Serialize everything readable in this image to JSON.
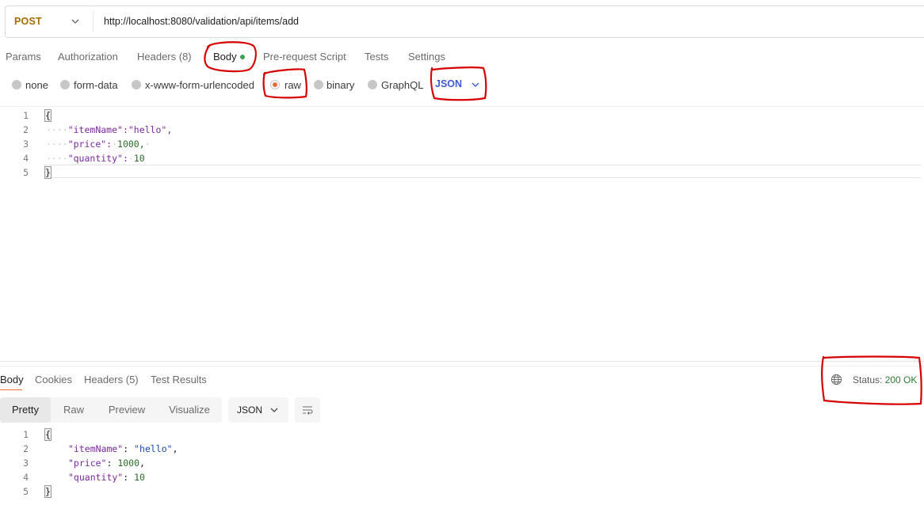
{
  "request": {
    "method": "POST",
    "url": "http://localhost:8080/validation/api/items/add"
  },
  "request_tabs": {
    "params": "Params",
    "authorization": "Authorization",
    "headers": "Headers (8)",
    "body": "Body",
    "pre_request": "Pre-request Script",
    "tests": "Tests",
    "settings": "Settings"
  },
  "body_types": {
    "none": "none",
    "form_data": "form-data",
    "urlencoded": "x-www-form-urlencoded",
    "raw": "raw",
    "binary": "binary",
    "graphql": "GraphQL",
    "selected": "raw",
    "format": "JSON"
  },
  "request_body": {
    "line_numbers": [
      "1",
      "2",
      "3",
      "4",
      "5"
    ],
    "open_brace": "{",
    "line2_key": "\"itemName\":\"hello\",",
    "line3_key": "\"price\":",
    "line3_val": "1000,",
    "line4_key": "\"quantity\":",
    "line4_val": "10",
    "close_brace": "}"
  },
  "response_tabs": {
    "body": "Body",
    "cookies": "Cookies",
    "headers": "Headers (5)",
    "test_results": "Test Results"
  },
  "status": {
    "label": "Status:",
    "value": "200 OK"
  },
  "view_modes": {
    "pretty": "Pretty",
    "raw": "Raw",
    "preview": "Preview",
    "visualize": "Visualize",
    "format": "JSON"
  },
  "response_body": {
    "line_numbers": [
      "1",
      "2",
      "3",
      "4",
      "5"
    ],
    "open_brace": "{",
    "l2_key": "\"itemName\"",
    "l2_val": "\"hello\"",
    "l3_key": "\"price\"",
    "l3_val": "1000",
    "l4_key": "\"quantity\"",
    "l4_val": "10",
    "close_brace": "}"
  },
  "colors": {
    "method": "#a36c00",
    "accent": "#f26b3a",
    "json_blue": "#3d5ccc",
    "status_ok": "#2e7d32",
    "annotation": "#d60000"
  }
}
